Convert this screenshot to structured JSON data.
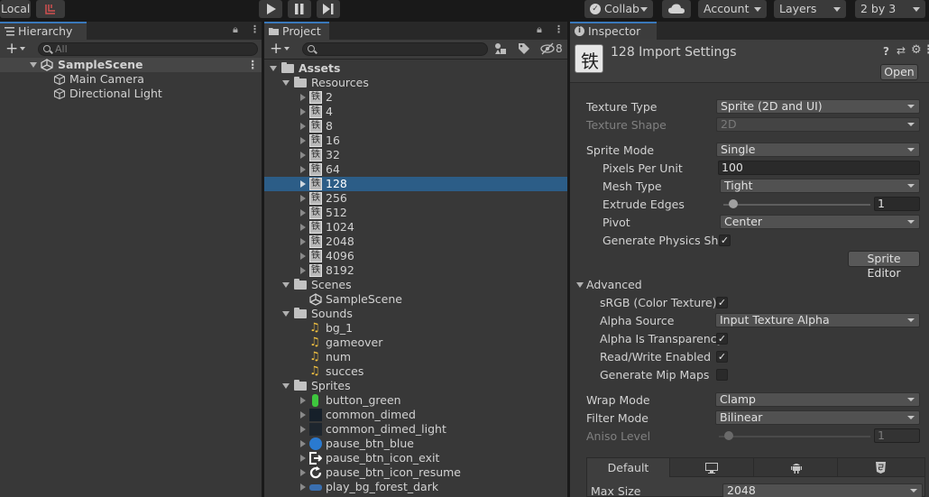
{
  "toolbar": {
    "local_label": "Local",
    "collab_label": "Collab",
    "account_label": "Account",
    "layers_label": "Layers",
    "layout_label": "2 by 3"
  },
  "hierarchy": {
    "tab_label": "Hierarchy",
    "search_placeholder": "All",
    "scene": "SampleScene",
    "objects": [
      "Main Camera",
      "Directional Light"
    ]
  },
  "project": {
    "tab_label": "Project",
    "hidden_count": "8",
    "root": "Assets",
    "resources_label": "Resources",
    "resources": [
      "2",
      "4",
      "8",
      "16",
      "32",
      "64",
      "128",
      "256",
      "512",
      "1024",
      "2048",
      "4096",
      "8192"
    ],
    "selected": "128",
    "scenes_label": "Scenes",
    "scenes": [
      "SampleScene"
    ],
    "sounds_label": "Sounds",
    "sounds": [
      "bg_1",
      "gameover",
      "num",
      "succes"
    ],
    "sprites_label": "Sprites",
    "sprites": [
      "button_green",
      "common_dimed",
      "common_dimed_light",
      "pause_btn_blue",
      "pause_btn_icon_exit",
      "pause_btn_icon_resume",
      "play_bg_forest_dark"
    ]
  },
  "inspector": {
    "tab_label": "Inspector",
    "title": "128 Import Settings",
    "open_label": "Open",
    "texture_type_label": "Texture Type",
    "texture_type_value": "Sprite (2D and UI)",
    "texture_shape_label": "Texture Shape",
    "texture_shape_value": "2D",
    "sprite_mode_label": "Sprite Mode",
    "sprite_mode_value": "Single",
    "ppu_label": "Pixels Per Unit",
    "ppu_value": "100",
    "mesh_type_label": "Mesh Type",
    "mesh_type_value": "Tight",
    "extrude_label": "Extrude Edges",
    "extrude_value": "1",
    "extrude_level": 0.07,
    "pivot_label": "Pivot",
    "pivot_value": "Center",
    "physics_label": "Generate Physics Shap",
    "sprite_editor_label": "Sprite Editor",
    "advanced_label": "Advanced",
    "srgb_label": "sRGB (Color Texture)",
    "alpha_source_label": "Alpha Source",
    "alpha_source_value": "Input Texture Alpha",
    "alpha_transp_label": "Alpha Is Transparency",
    "readwrite_label": "Read/Write Enabled",
    "mipmaps_label": "Generate Mip Maps",
    "wrap_label": "Wrap Mode",
    "wrap_value": "Clamp",
    "filter_label": "Filter Mode",
    "filter_value": "Bilinear",
    "aniso_label": "Aniso Level",
    "aniso_value": "1",
    "platform_default_label": "Default",
    "maxsize_label": "Max Size",
    "maxsize_value": "2048"
  },
  "colors": {
    "selection": "#2c5d87",
    "tab_accent": "#3a79bb",
    "panel_bg": "#383838"
  }
}
